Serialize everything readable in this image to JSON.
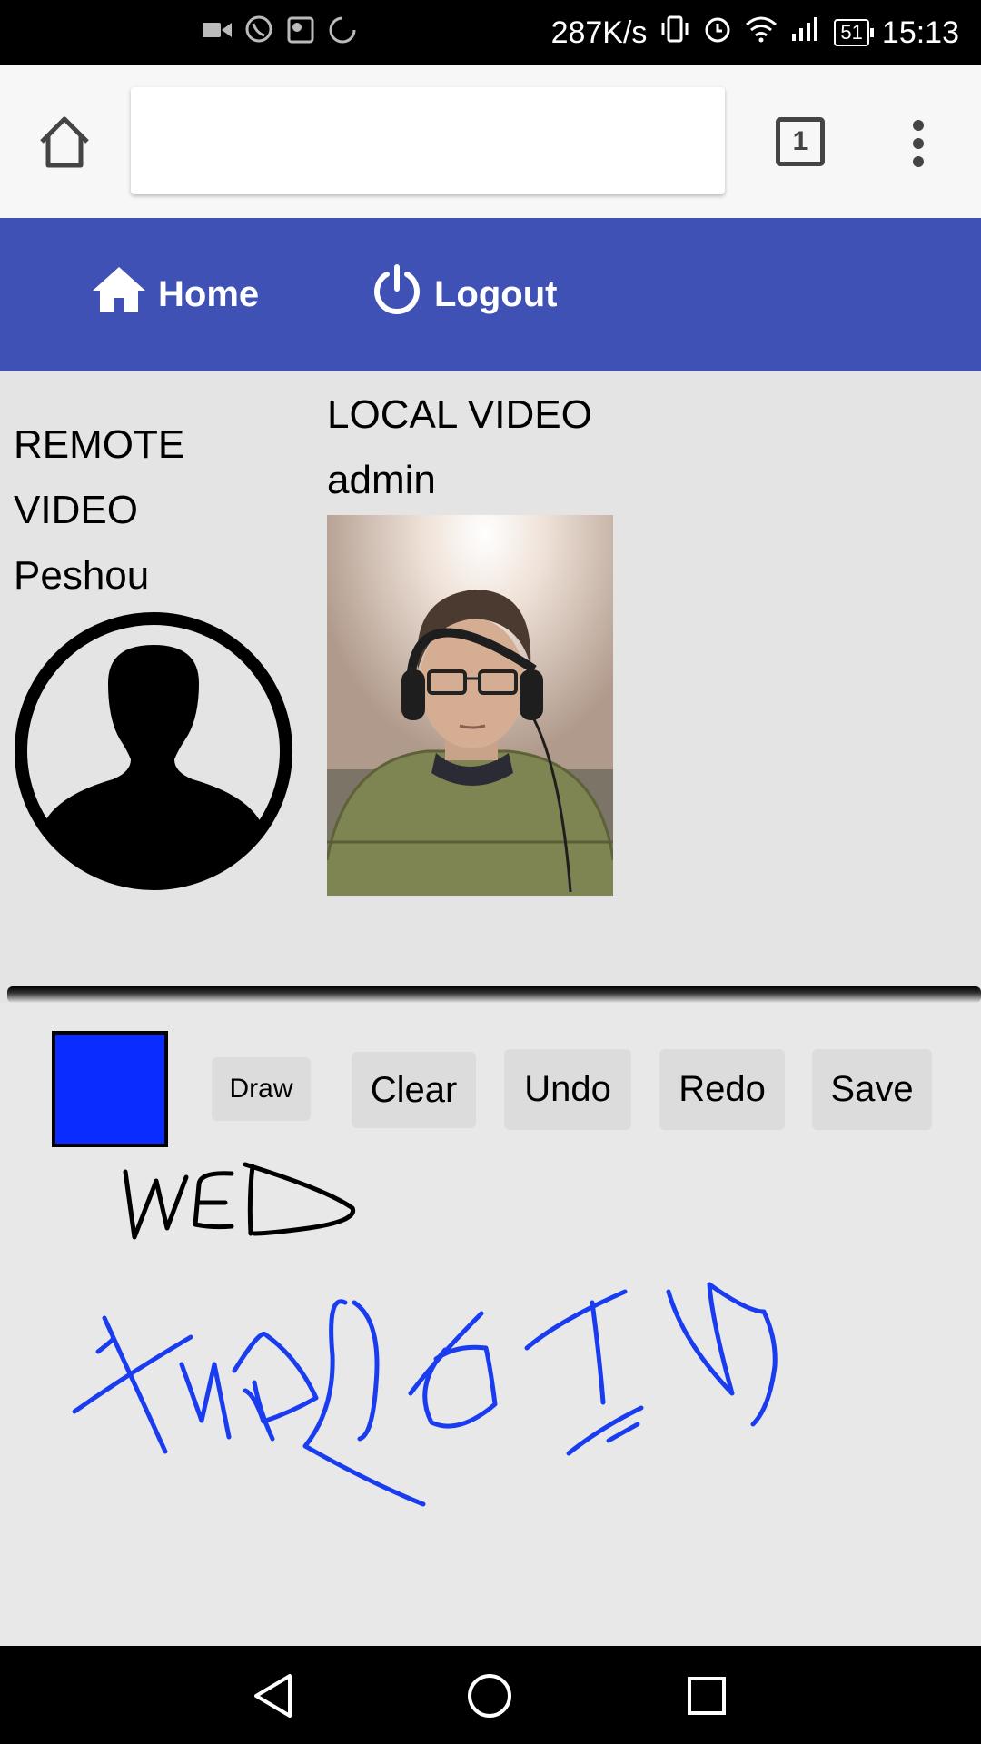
{
  "status_bar": {
    "network_speed": "287K/s",
    "battery": "51",
    "time": "15:13",
    "icons": [
      "video-call-icon",
      "viber-icon",
      "maps-icon",
      "sync-icon",
      "vibrate-icon",
      "alarm-icon",
      "wifi-icon",
      "signal-icon",
      "battery-icon"
    ]
  },
  "browser": {
    "tab_count": "1"
  },
  "nav": {
    "home_label": "Home",
    "logout_label": "Logout"
  },
  "remote": {
    "title_line1": "REMOTE",
    "title_line2": "VIDEO",
    "user": "Peshou"
  },
  "local": {
    "title": "LOCAL VIDEO",
    "user": "admin"
  },
  "whiteboard": {
    "color": "#0a2cff",
    "buttons": {
      "draw": "Draw",
      "clear": "Clear",
      "undo": "Undo",
      "redo": "Redo",
      "save": "Save"
    }
  },
  "colors": {
    "nav_bg": "#3f51b5",
    "stroke_black": "#000000",
    "stroke_blue": "#1a3cf0"
  }
}
